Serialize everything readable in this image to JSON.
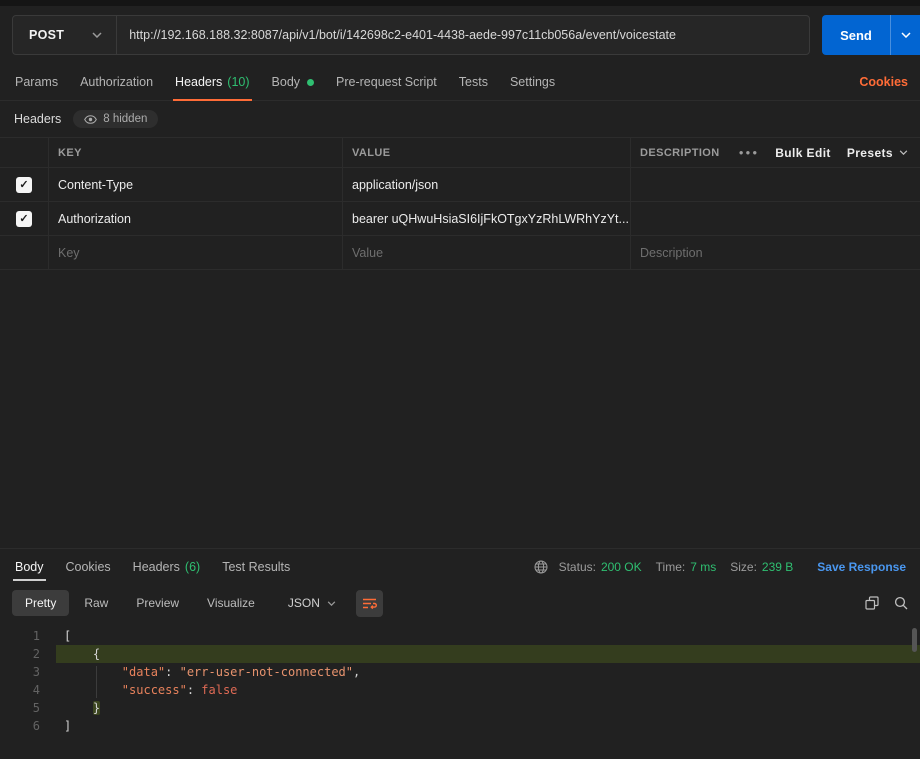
{
  "colors": {
    "accent_orange": "#ff6c37",
    "send_blue": "#0265d2",
    "status_green": "#2fbf71",
    "link_blue": "#4a97ef",
    "active_line_olive": "#343d1e"
  },
  "icons": {
    "method_caret": "chevron-down",
    "eye": "eye",
    "more_options": "•••",
    "presets_caret": "chevron-down",
    "globe": "globe",
    "json_caret": "chevron-down",
    "wrap_text": "wrap-lines",
    "copy": "copy",
    "search": "magnifier",
    "checkbox_check": "✓"
  },
  "request_bar": {
    "method": "POST",
    "url": "http://192.168.188.32:8087/api/v1/bot/i/142698c2-e401-4438-aede-997c11cb056a/event/voicestate",
    "send": "Send"
  },
  "request_tabs": {
    "items": [
      {
        "label": "Params"
      },
      {
        "label": "Authorization"
      },
      {
        "label": "Headers",
        "count": "(10)",
        "active": true
      },
      {
        "label": "Body",
        "dot": true
      },
      {
        "label": "Pre-request Script"
      },
      {
        "label": "Tests"
      },
      {
        "label": "Settings"
      }
    ],
    "cookies": "Cookies"
  },
  "headers_panel": {
    "title": "Headers",
    "hidden_badge": "8 hidden",
    "columns": {
      "key": "KEY",
      "value": "VALUE",
      "description": "DESCRIPTION"
    },
    "bulk_edit": "Bulk Edit",
    "presets": "Presets",
    "rows": [
      {
        "checked": true,
        "key": "Content-Type",
        "value": "application/json",
        "description": ""
      },
      {
        "checked": true,
        "key": "Authorization",
        "value": "bearer uQHwuHsiaSI6IjFkOTgxYzRhLWRhYzYt...",
        "description": ""
      }
    ],
    "placeholders": {
      "key": "Key",
      "value": "Value",
      "description": "Description"
    }
  },
  "response_panel": {
    "tabs": [
      {
        "label": "Body",
        "active": true
      },
      {
        "label": "Cookies"
      },
      {
        "label": "Headers",
        "count": "(6)"
      },
      {
        "label": "Test Results"
      }
    ],
    "status_label": "Status:",
    "status_value": "200 OK",
    "time_label": "Time:",
    "time_value": "7 ms",
    "size_label": "Size:",
    "size_value": "239 B",
    "save_response": "Save Response",
    "view_tabs": [
      {
        "label": "Pretty",
        "active": true
      },
      {
        "label": "Raw"
      },
      {
        "label": "Preview"
      },
      {
        "label": "Visualize"
      }
    ],
    "format": "JSON",
    "code": {
      "lines": [
        {
          "num": "1",
          "tokens": [
            {
              "c": "p",
              "t": "["
            }
          ]
        },
        {
          "num": "2",
          "active": true,
          "tokens": [
            {
              "c": "p",
              "t": "    {"
            }
          ]
        },
        {
          "num": "3",
          "tokens": [
            {
              "c": "p",
              "t": "        "
            },
            {
              "c": "k",
              "t": "\"data\""
            },
            {
              "c": "p",
              "t": ": "
            },
            {
              "c": "s",
              "t": "\"err-user-not-connected\""
            },
            {
              "c": "p",
              "t": ","
            }
          ]
        },
        {
          "num": "4",
          "tokens": [
            {
              "c": "p",
              "t": "        "
            },
            {
              "c": "k",
              "t": "\"success\""
            },
            {
              "c": "p",
              "t": ": "
            },
            {
              "c": "b",
              "t": "false"
            }
          ]
        },
        {
          "num": "5",
          "tokens": [
            {
              "c": "p",
              "t": "    "
            },
            {
              "c": "m",
              "t": "}"
            }
          ]
        },
        {
          "num": "6",
          "tokens": [
            {
              "c": "p",
              "t": "]"
            }
          ]
        }
      ]
    }
  }
}
